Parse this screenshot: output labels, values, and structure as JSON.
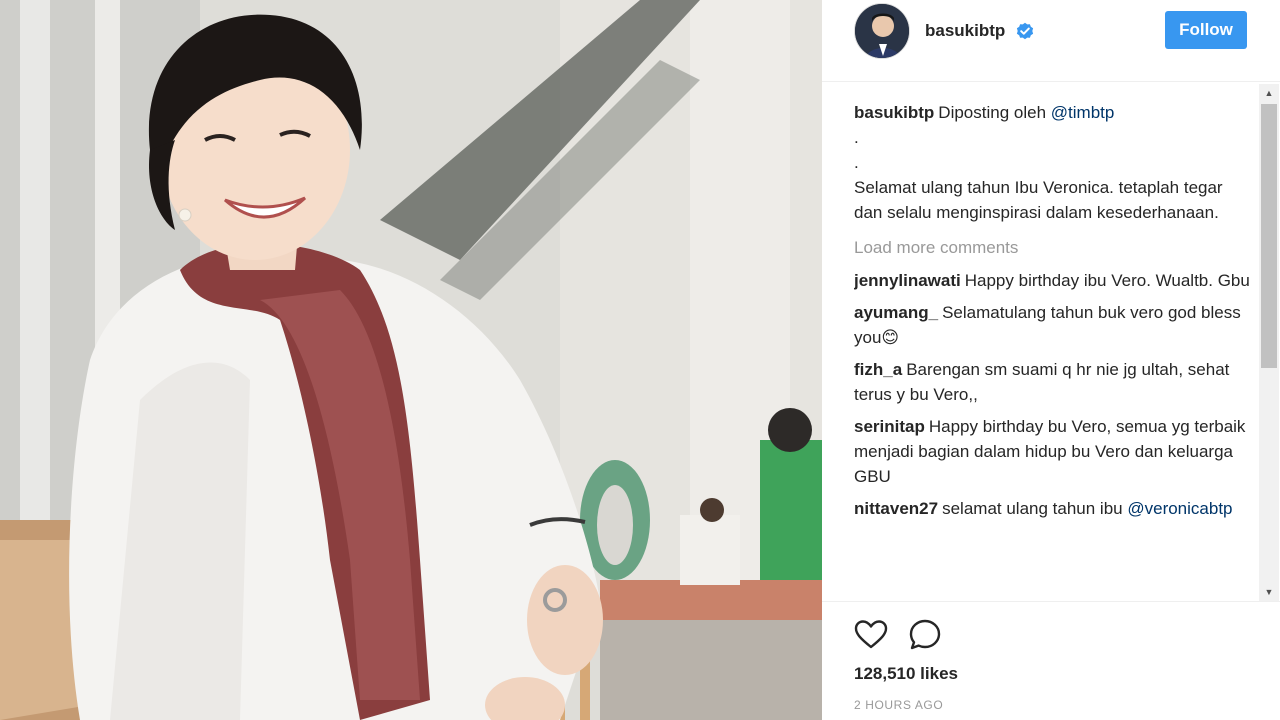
{
  "post": {
    "username": "basukibtp",
    "follow_label": "Follow",
    "caption": {
      "username": "basukibtp",
      "text": "Diposting oleh",
      "mention": "@timbtp",
      "dot1": ".",
      "dot2": ".",
      "body": "Selamat ulang tahun Ibu Veronica. tetaplah tegar dan selalu menginspirasi dalam kesederhanaan."
    },
    "load_more": "Load more comments",
    "comments": [
      {
        "username": "jennylinawati",
        "text": "Happy birthday ibu Vero. Wualtb. Gbu"
      },
      {
        "username": "ayumang_",
        "text": "Selamatulang tahun buk vero god bless you😊"
      },
      {
        "username": "fizh_a",
        "text": "Barengan sm suami q hr nie jg ultah, sehat terus y bu Vero,,"
      },
      {
        "username": "serinitap",
        "text": "Happy birthday bu Vero, semua yg terbaik menjadi bagian dalam hidup bu Vero dan keluarga GBU"
      },
      {
        "username": "nittaven27",
        "text": "selamat ulang tahun ibu",
        "mention": "@veronicabtp"
      }
    ],
    "likes": "128,510 likes",
    "time": "2 HOURS AGO"
  },
  "icons": {
    "verified": "verified-badge-icon",
    "like": "heart-icon",
    "comment": "speech-bubble-icon",
    "scroll_up": "scroll-up-arrow-icon",
    "scroll_down": "scroll-down-arrow-icon"
  },
  "colors": {
    "follow_button": "#3897f0",
    "mention": "#003569",
    "muted": "#999999",
    "verified": "#3897f0"
  }
}
